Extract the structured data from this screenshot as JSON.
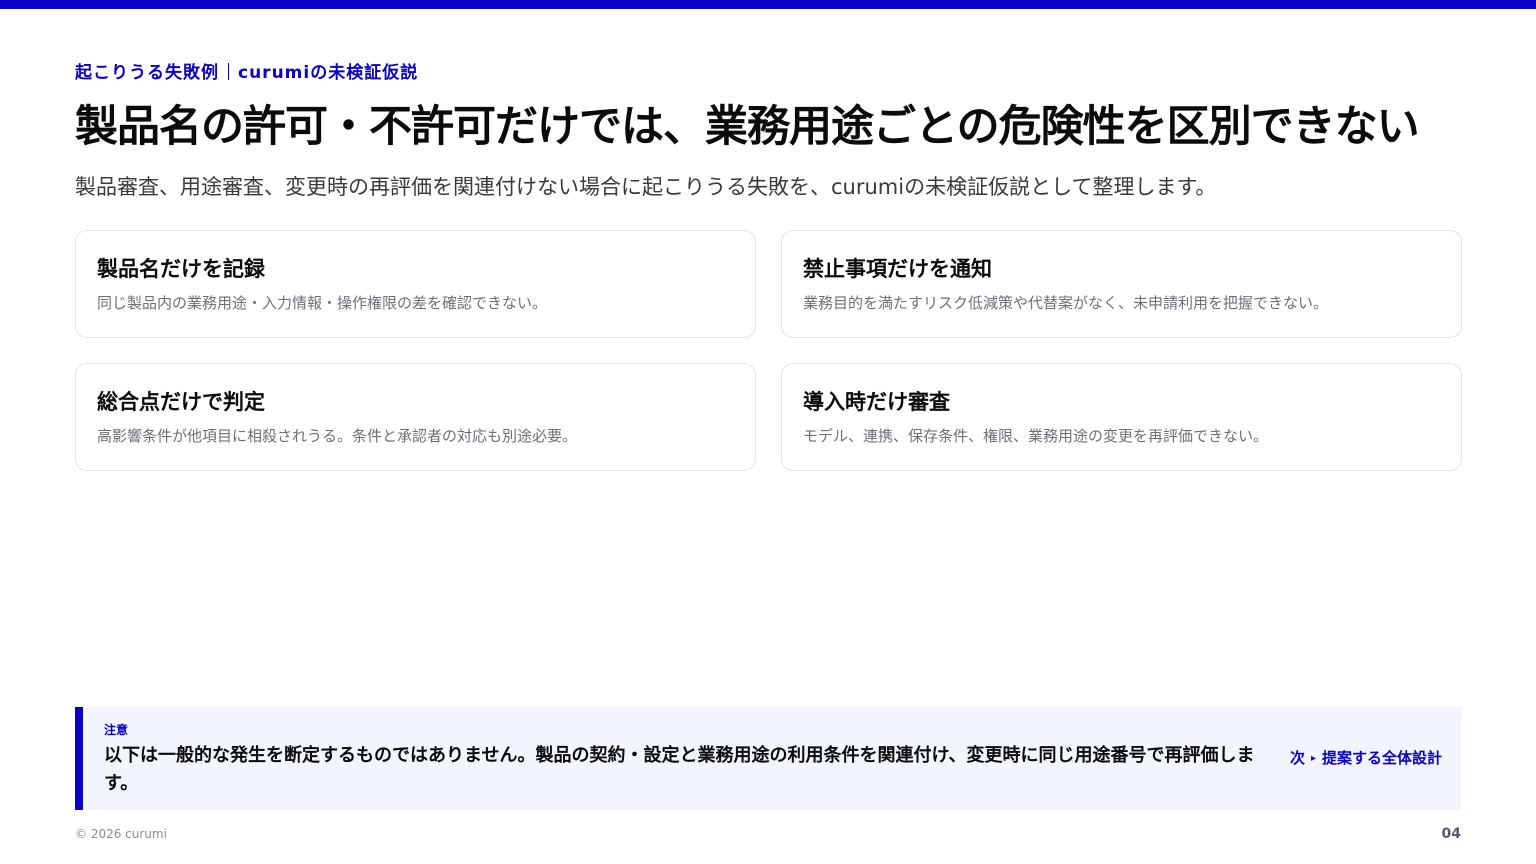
{
  "colors": {
    "accent": "#0a00c8",
    "note_background": "#f2f5fd",
    "card_border": "#e3e3ea",
    "muted_text": "#6f6f76"
  },
  "header": {
    "eyebrow_primary": "起こりうる失敗例",
    "eyebrow_secondary": "curumiの未検証仮説",
    "title": "製品名の許可・不許可だけでは、業務用途ごとの危険性を区別できない",
    "subtitle": "製品審査、用途審査、変更時の再評価を関連付けない場合に起こりうる失敗を、curumiの未検証仮説として整理します。"
  },
  "cards": [
    {
      "title": "製品名だけを記録",
      "text": "同じ製品内の業務用途・入力情報・操作権限の差を確認できない。"
    },
    {
      "title": "禁止事項だけを通知",
      "text": "業務目的を満たすリスク低減策や代替案がなく、未申請利用を把握できない。"
    },
    {
      "title": "総合点だけで判定",
      "text": "高影響条件が他項目に相殺されうる。条件と承認者の対応も別途必要。"
    },
    {
      "title": "導入時だけ審査",
      "text": "モデル、連携、保存条件、権限、業務用途の変更を再評価できない。"
    }
  ],
  "note": {
    "label": "注意",
    "text": "以下は一般的な発生を断定するものではありません。製品の契約・設定と業務用途の利用条件を関連付け、変更時に同じ用途番号で再評価します。",
    "next_prefix": "次",
    "next_arrow": "▸",
    "next_label": "提案する全体設計"
  },
  "footer": {
    "copyright": "© 2026 curumi",
    "page_number": "04"
  }
}
